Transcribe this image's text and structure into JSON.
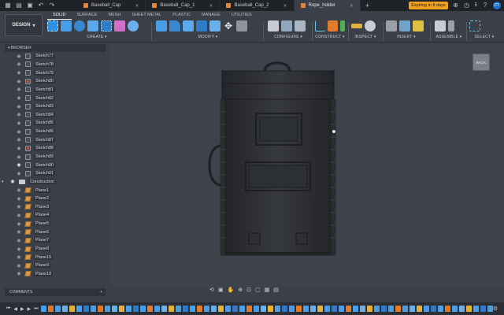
{
  "tabs": [
    {
      "label": "Baseball_Cap",
      "active": false
    },
    {
      "label": "Baseball_Cap_1",
      "active": false
    },
    {
      "label": "Baseball_Cap_2",
      "active": false
    },
    {
      "label": "Rope_holder",
      "active": true
    }
  ],
  "header": {
    "expiring": "Expiring in 8 days",
    "notifications_count": "5",
    "user_initials": "FT"
  },
  "toolbar": {
    "design_label": "DESIGN",
    "workspace_tabs": [
      "SOLID",
      "SURFACE",
      "MESH",
      "SHEET METAL",
      "PLASTIC",
      "MANAGE",
      "UTILITIES"
    ],
    "active_workspace": "SOLID",
    "groups": {
      "create": "CREATE",
      "modify": "MODIFY",
      "configure": "CONFIGURE",
      "construct": "CONSTRUCT",
      "inspect": "INSPECT",
      "insert": "INSERT",
      "assemble": "ASSEMBLE",
      "select": "SELECT"
    }
  },
  "browser": {
    "title": "BROWSER",
    "rows": [
      {
        "label": "Sketch77",
        "type": "sketch",
        "visible": false
      },
      {
        "label": "Sketch78",
        "type": "sketch",
        "visible": false
      },
      {
        "label": "Sketch79",
        "type": "sketch",
        "visible": false
      },
      {
        "label": "Sketch80",
        "type": "sketch-red",
        "visible": false
      },
      {
        "label": "Sketch81",
        "type": "sketch",
        "visible": false
      },
      {
        "label": "Sketch82",
        "type": "sketch",
        "visible": false
      },
      {
        "label": "Sketch83",
        "type": "sketch",
        "visible": false
      },
      {
        "label": "Sketch84",
        "type": "sketch",
        "visible": false
      },
      {
        "label": "Sketch85",
        "type": "sketch",
        "visible": false
      },
      {
        "label": "Sketch86",
        "type": "sketch",
        "visible": false
      },
      {
        "label": "Sketch87",
        "type": "sketch",
        "visible": false
      },
      {
        "label": "Sketch88",
        "type": "sketch-red",
        "visible": false
      },
      {
        "label": "Sketch89",
        "type": "sketch",
        "visible": false
      },
      {
        "label": "Sketch90",
        "type": "sketch",
        "visible": true
      },
      {
        "label": "Sketch91",
        "type": "sketch",
        "visible": false
      },
      {
        "label": "Construction",
        "type": "folder",
        "visible": true
      },
      {
        "label": "Plane1",
        "type": "plane",
        "visible": false
      },
      {
        "label": "Plane2",
        "type": "plane",
        "visible": false
      },
      {
        "label": "Plane3",
        "type": "plane",
        "visible": false
      },
      {
        "label": "Plane4",
        "type": "plane",
        "visible": false
      },
      {
        "label": "Plane5",
        "type": "plane",
        "visible": false
      },
      {
        "label": "Plane6",
        "type": "plane",
        "visible": false
      },
      {
        "label": "Plane7",
        "type": "plane",
        "visible": false
      },
      {
        "label": "Plane8",
        "type": "plane",
        "visible": false
      },
      {
        "label": "Plane15",
        "type": "plane",
        "visible": false
      },
      {
        "label": "Plane9",
        "type": "plane",
        "visible": false
      },
      {
        "label": "Plane10",
        "type": "plane",
        "visible": false
      }
    ]
  },
  "viewcube_label": "BACK",
  "comments_label": "COMMENTS",
  "colors": {
    "accent_blue": "#2f8fe0",
    "expiring_orange": "#f0a020",
    "model_dark": "#2a2c30"
  }
}
